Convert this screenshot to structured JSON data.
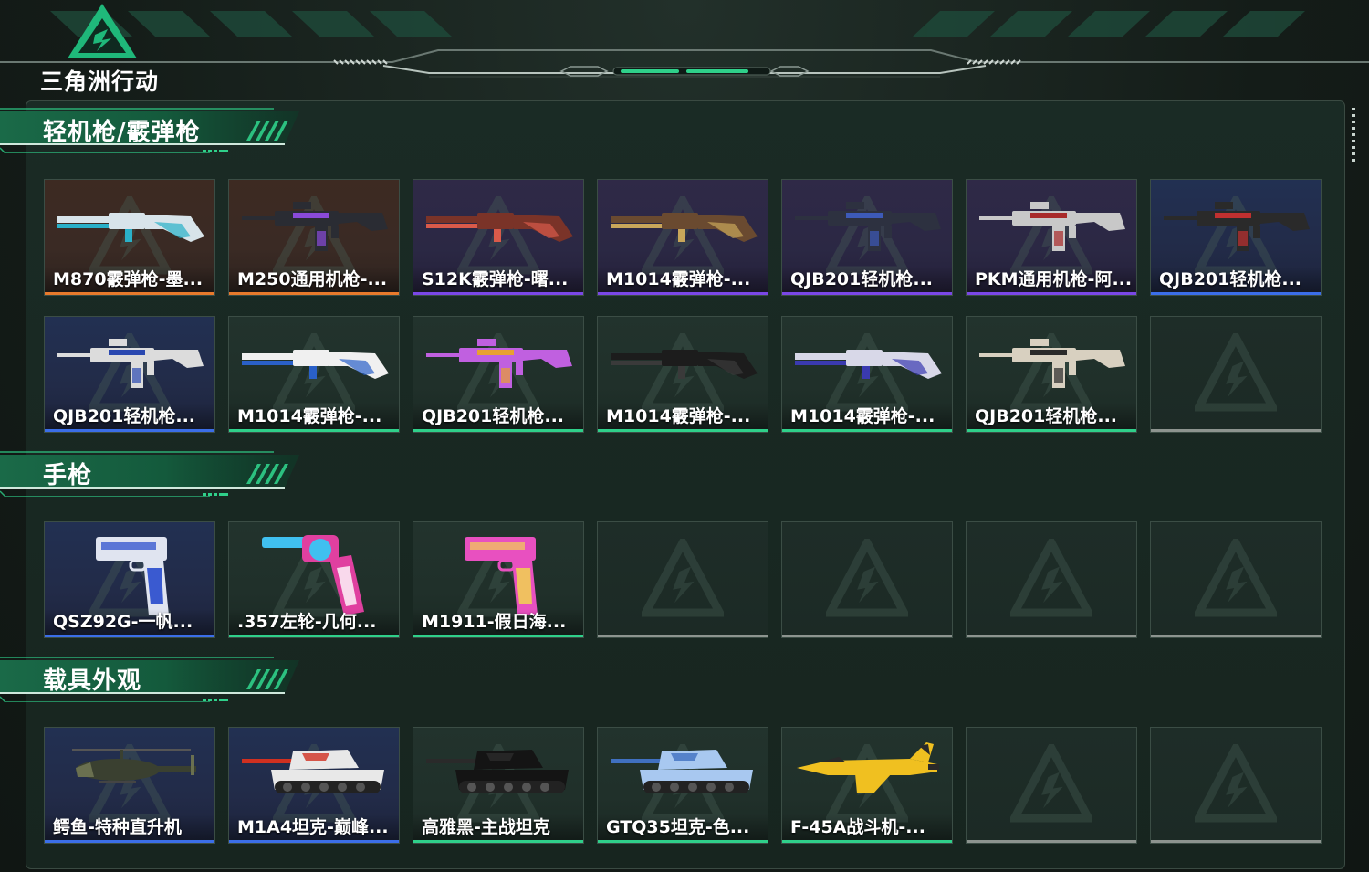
{
  "app": {
    "logo_text": "三角洲行动"
  },
  "sections": [
    {
      "title": "轻机枪/霰弹枪",
      "items": [
        {
          "label": "M870霰弹枪-墨...",
          "rarity": "orange",
          "icon": "shotgun-icon",
          "palette": [
            "#d8e4ea",
            "#2ab0c8"
          ]
        },
        {
          "label": "M250通用机枪-...",
          "rarity": "orange",
          "icon": "machine-gun-icon",
          "palette": [
            "#2a2c33",
            "#8a4ad8"
          ]
        },
        {
          "label": "S12K霰弹枪-曙...",
          "rarity": "purple",
          "icon": "shotgun-icon",
          "palette": [
            "#7a3328",
            "#d95a4a"
          ]
        },
        {
          "label": "M1014霰弹枪-...",
          "rarity": "purple",
          "icon": "shotgun-icon",
          "palette": [
            "#6a4a30",
            "#c9a65a"
          ]
        },
        {
          "label": "QJB201轻机枪...",
          "rarity": "purple",
          "icon": "machine-gun-icon",
          "palette": [
            "#2d3140",
            "#3d5ab8"
          ]
        },
        {
          "label": "PKM通用机枪-阿...",
          "rarity": "purple",
          "icon": "machine-gun-icon",
          "palette": [
            "#c8c8c8",
            "#a82a2a"
          ]
        },
        {
          "label": "QJB201轻机枪...",
          "rarity": "blue",
          "icon": "machine-gun-icon",
          "palette": [
            "#2a2a2a",
            "#c03030"
          ]
        },
        {
          "label": "QJB201轻机枪...",
          "rarity": "blue",
          "icon": "machine-gun-icon",
          "palette": [
            "#dcdcdc",
            "#2a48b0"
          ]
        },
        {
          "label": "M1014霰弹枪-...",
          "rarity": "green",
          "icon": "shotgun-icon",
          "palette": [
            "#f0f0f0",
            "#2a60c8"
          ]
        },
        {
          "label": "QJB201轻机枪...",
          "rarity": "green",
          "icon": "machine-gun-icon",
          "palette": [
            "#c060e0",
            "#e8a030"
          ]
        },
        {
          "label": "M1014霰弹枪-...",
          "rarity": "green",
          "icon": "shotgun-icon",
          "palette": [
            "#1c1c1c",
            "#3a3a3a"
          ]
        },
        {
          "label": "M1014霰弹枪-...",
          "rarity": "green",
          "icon": "shotgun-icon",
          "palette": [
            "#d8d8e8",
            "#3a3ab0"
          ]
        },
        {
          "label": "QJB201轻机枪...",
          "rarity": "green",
          "icon": "machine-gun-icon",
          "palette": [
            "#d8d0c0",
            "#2a2a2a"
          ]
        },
        {
          "label": "",
          "rarity": "empty",
          "icon": "empty-slot-logo-icon"
        }
      ]
    },
    {
      "title": "手枪",
      "items": [
        {
          "label": "QSZ92G-一帆...",
          "rarity": "blue",
          "icon": "pistol-icon",
          "palette": [
            "#e0e4f0",
            "#3a5ad0"
          ]
        },
        {
          "label": ".357左轮-几何...",
          "rarity": "green",
          "icon": "revolver-icon",
          "palette": [
            "#e040a0",
            "#40c0f0"
          ]
        },
        {
          "label": "M1911-假日海...",
          "rarity": "green",
          "icon": "pistol-icon",
          "palette": [
            "#e850c0",
            "#f0c060"
          ]
        },
        {
          "label": "",
          "rarity": "empty",
          "icon": "empty-slot-logo-icon"
        },
        {
          "label": "",
          "rarity": "empty",
          "icon": "empty-slot-logo-icon"
        },
        {
          "label": "",
          "rarity": "empty",
          "icon": "empty-slot-logo-icon"
        },
        {
          "label": "",
          "rarity": "empty",
          "icon": "empty-slot-logo-icon"
        }
      ]
    },
    {
      "title": "载具外观",
      "items": [
        {
          "label": "鳄鱼-特种直升机",
          "rarity": "blue",
          "icon": "helicopter-icon",
          "palette": [
            "#3a4030",
            "#6a7050"
          ]
        },
        {
          "label": "M1A4坦克-巅峰...",
          "rarity": "blue",
          "icon": "tank-icon",
          "palette": [
            "#e8e8e8",
            "#d03020"
          ]
        },
        {
          "label": "高雅黑-主战坦克",
          "rarity": "green",
          "icon": "tank-icon",
          "palette": [
            "#141414",
            "#2a2a2a"
          ]
        },
        {
          "label": "GTQ35坦克-色...",
          "rarity": "green",
          "icon": "tank-icon",
          "palette": [
            "#a8c8f0",
            "#4070c0"
          ]
        },
        {
          "label": "F-45A战斗机-...",
          "rarity": "green",
          "icon": "fighter-jet-icon",
          "palette": [
            "#f0c020",
            "#2a2a2a"
          ]
        },
        {
          "label": "",
          "rarity": "empty",
          "icon": "empty-slot-logo-icon"
        },
        {
          "label": "",
          "rarity": "empty",
          "icon": "empty-slot-logo-icon"
        }
      ]
    }
  ],
  "colors": {
    "accent": "#2fd08a",
    "rarity_orange": "#e87a2c",
    "rarity_purple": "#7a47e6",
    "rarity_blue": "#3b6ee8",
    "rarity_green": "#2fd08a",
    "rarity_empty": "#8d948f"
  }
}
